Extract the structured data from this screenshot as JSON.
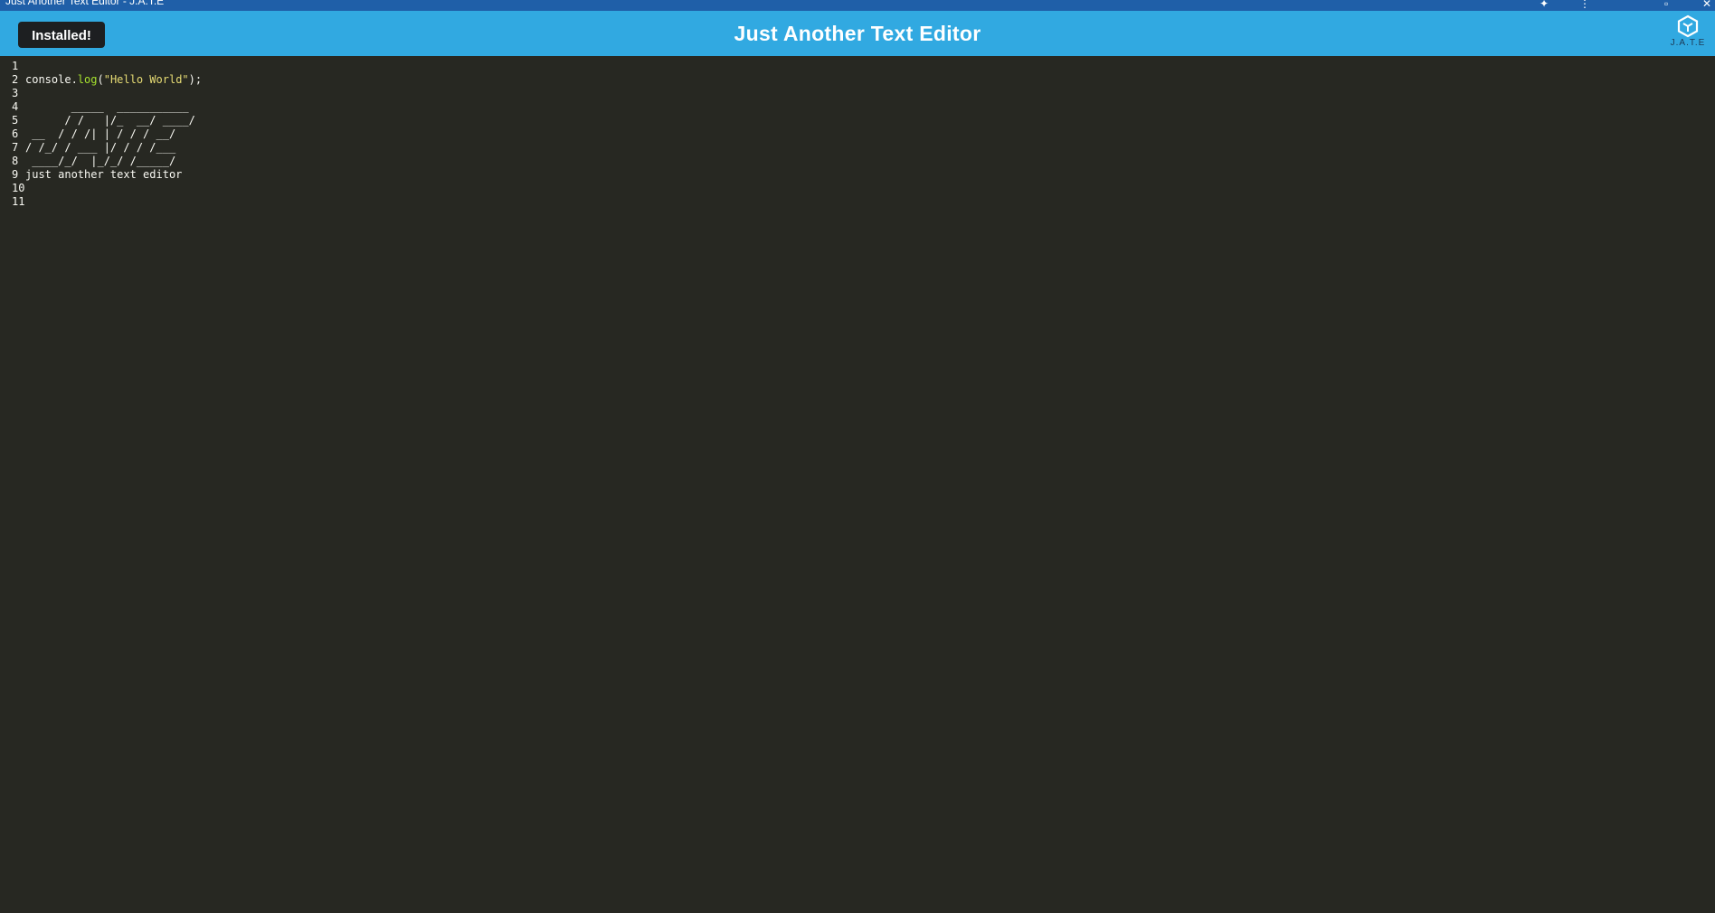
{
  "window": {
    "title": "Just Another Text Editor - J.A.T.E"
  },
  "navbar": {
    "install_label": "Installed!",
    "title": "Just Another Text Editor",
    "logo_text": "J.A.T.E",
    "logo_icon": "cube-logo-icon"
  },
  "colors": {
    "navbar": "#31a9e1",
    "titlebar": "#1f5fa8",
    "editor_bg": "#272822",
    "text": "#f8f8f2",
    "function": "#a6e22e",
    "string": "#e6db74",
    "button_bg": "#1d1f21"
  },
  "editor": {
    "lines": [
      {
        "num": "1",
        "text": ""
      },
      {
        "num": "2",
        "text": "console.log(\"Hello World\");"
      },
      {
        "num": "3",
        "text": ""
      },
      {
        "num": "4",
        "text": "       _____  ___________"
      },
      {
        "num": "5",
        "text": "      / /   |/_  __/ ____/"
      },
      {
        "num": "6",
        "text": " __  / / /| | / / / __/"
      },
      {
        "num": "7",
        "text": "/ /_/ / ___ |/ / / /___"
      },
      {
        "num": "8",
        "text": " ____/_/  |_/_/ /_____/"
      },
      {
        "num": "9",
        "text": "just another text editor"
      },
      {
        "num": "10",
        "text": ""
      },
      {
        "num": "11",
        "text": ""
      }
    ],
    "line2_tokens": {
      "obj": "console.",
      "fn": "log",
      "open": "(",
      "str": "\"Hello World\"",
      "close": ");"
    }
  }
}
